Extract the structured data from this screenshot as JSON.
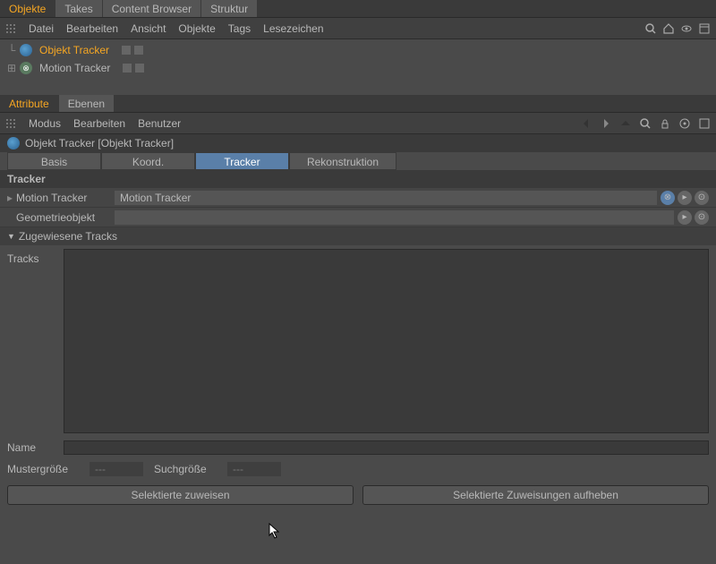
{
  "top_tabs": {
    "objekte": "Objekte",
    "takes": "Takes",
    "content_browser": "Content Browser",
    "struktur": "Struktur"
  },
  "top_menu": {
    "datei": "Datei",
    "bearbeiten": "Bearbeiten",
    "ansicht": "Ansicht",
    "objekte": "Objekte",
    "tags": "Tags",
    "lesezeichen": "Lesezeichen"
  },
  "tree": {
    "item1": {
      "label": "Objekt Tracker"
    },
    "item2": {
      "label": "Motion Tracker"
    }
  },
  "attr_tabs": {
    "attribute": "Attribute",
    "ebenen": "Ebenen"
  },
  "attr_menu": {
    "modus": "Modus",
    "bearbeiten": "Bearbeiten",
    "benutzer": "Benutzer"
  },
  "object_header": "Objekt Tracker [Objekt Tracker]",
  "subtabs": {
    "basis": "Basis",
    "koord": "Koord.",
    "tracker": "Tracker",
    "rekonstruktion": "Rekonstruktion"
  },
  "section_tracker": "Tracker",
  "fields": {
    "motion_tracker_label": "Motion Tracker",
    "motion_tracker_value": "Motion Tracker",
    "geometrie_label": "Geometrieobjekt",
    "geometrie_value": ""
  },
  "zugewiesene": "Zugewiesene Tracks",
  "tracks_label": "Tracks",
  "name_label": "Name",
  "muster_label": "Mustergröße",
  "muster_value": "---",
  "such_label": "Suchgröße",
  "such_value": "---",
  "btn_assign": "Selektierte zuweisen",
  "btn_unassign": "Selektierte Zuweisungen aufheben"
}
